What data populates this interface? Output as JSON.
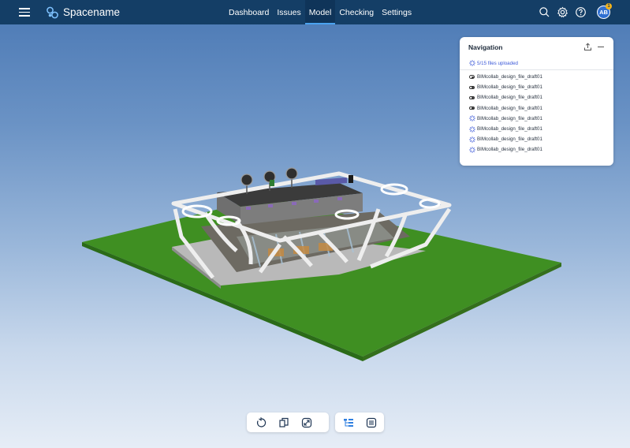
{
  "app": {
    "name": "Spacename"
  },
  "header": {
    "tabs": [
      {
        "label": "Dashboard",
        "active": false
      },
      {
        "label": "Issues",
        "active": false
      },
      {
        "label": "Model",
        "active": true
      },
      {
        "label": "Checking",
        "active": false
      },
      {
        "label": "Settings",
        "active": false
      }
    ],
    "icons": [
      "search-icon",
      "settings-gear-icon",
      "help-icon"
    ],
    "avatar_initials": "AB",
    "notification_count": "1"
  },
  "navigation_panel": {
    "title": "Navigation",
    "upload_status": "5/15 files uploaded",
    "files": [
      {
        "name": "BIMcollab_design_file_draft01",
        "state": "loaded"
      },
      {
        "name": "BIMcollab_design_file_draft01",
        "state": "loaded"
      },
      {
        "name": "BIMcollab_design_file_draft01",
        "state": "loaded"
      },
      {
        "name": "BIMcollab_design_file_draft01",
        "state": "loaded"
      },
      {
        "name": "BIMcollab_design_file_draft01",
        "state": "uploading"
      },
      {
        "name": "BIMcollab_design_file_draft01",
        "state": "uploading"
      },
      {
        "name": "BIMcollab_design_file_draft01",
        "state": "uploading"
      },
      {
        "name": "BIMcollab_design_file_draft01",
        "state": "uploading"
      }
    ]
  },
  "toolbar": {
    "view_tools": [
      "reset-view-icon",
      "section-box-icon",
      "fit-view-icon"
    ],
    "panel_tools": [
      "model-tree-icon",
      "properties-list-icon"
    ]
  },
  "colors": {
    "header_bg": "#143e66",
    "accent": "#4aa3f0",
    "upload_text": "#3b58d8",
    "ground": "#3f8f22"
  }
}
